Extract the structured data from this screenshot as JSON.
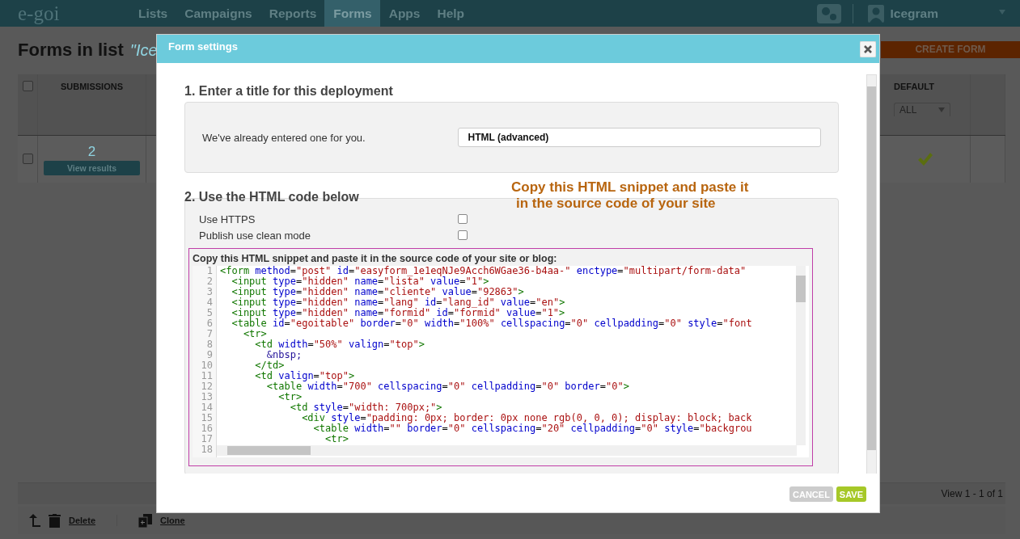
{
  "navbar": {
    "logo": "e-goi",
    "menu": [
      {
        "label": "Lists",
        "selected": false
      },
      {
        "label": "Campaigns",
        "selected": false
      },
      {
        "label": "Reports",
        "selected": false
      },
      {
        "label": "Forms",
        "selected": true
      },
      {
        "label": "Apps",
        "selected": false
      },
      {
        "label": "Help",
        "selected": false
      }
    ],
    "user": "Icegram"
  },
  "page": {
    "title": "Forms in list",
    "list_name": "\"Ice",
    "create_button": "CREATE FORM"
  },
  "table": {
    "all_checked": false,
    "submissions_header": "SUBMISSIONS",
    "default_header": "DEFAULT",
    "default_filter": "ALL",
    "rows": [
      {
        "checked": false,
        "submissions": "2",
        "action": "View results",
        "default": true
      }
    ],
    "pager": "View 1 - 1 of 1"
  },
  "toolbar": [
    {
      "kind": "delete",
      "label": "Delete"
    },
    {
      "kind": "clone",
      "label": "Clone"
    }
  ],
  "modal": {
    "title": "Form settings",
    "step1": {
      "heading": "1. Enter a title for this deployment",
      "label": "We've already entered one for you.",
      "value": "HTML (advanced)"
    },
    "step2": {
      "heading": "2. Use the HTML code below",
      "callout": [
        "Copy this HTML snippet and paste it",
        "in the source code of your site"
      ],
      "options": [
        {
          "label": "Use HTTPS",
          "checked": false
        },
        {
          "label": "Publish use clean mode",
          "checked": false
        }
      ],
      "snippet_label": "Copy this HTML snippet and paste it in the source code of your site or blog:",
      "lines": [
        {
          "n": "1",
          "code": [
            {
              "kind": "tag",
              "text": "<form"
            },
            {
              "kind": "attr",
              "text": " method"
            },
            {
              "kind": "op",
              "text": "="
            },
            {
              "kind": "str",
              "text": "\"post\""
            },
            {
              "kind": "attr",
              "text": " id"
            },
            {
              "kind": "op",
              "text": "="
            },
            {
              "kind": "str",
              "text": "\"easyform_1e1eqNJe9Acch6WGae36-b4aa-\""
            },
            {
              "kind": "attr",
              "text": " enctype"
            },
            {
              "kind": "op",
              "text": "="
            },
            {
              "kind": "str",
              "text": "\"multipart/form-data\""
            }
          ]
        },
        {
          "n": "2",
          "code": [
            {
              "kind": "tag",
              "text": "  <input"
            },
            {
              "kind": "attr",
              "text": " type"
            },
            {
              "kind": "op",
              "text": "="
            },
            {
              "kind": "str",
              "text": "\"hidden\""
            },
            {
              "kind": "attr",
              "text": " name"
            },
            {
              "kind": "op",
              "text": "="
            },
            {
              "kind": "str",
              "text": "\"lista\""
            },
            {
              "kind": "attr",
              "text": " value"
            },
            {
              "kind": "op",
              "text": "="
            },
            {
              "kind": "str",
              "text": "\"1\""
            },
            {
              "kind": "tag",
              "text": ">"
            }
          ]
        },
        {
          "n": "3",
          "code": [
            {
              "kind": "tag",
              "text": "  <input"
            },
            {
              "kind": "attr",
              "text": " type"
            },
            {
              "kind": "op",
              "text": "="
            },
            {
              "kind": "str",
              "text": "\"hidden\""
            },
            {
              "kind": "attr",
              "text": " name"
            },
            {
              "kind": "op",
              "text": "="
            },
            {
              "kind": "str",
              "text": "\"cliente\""
            },
            {
              "kind": "attr",
              "text": " value"
            },
            {
              "kind": "op",
              "text": "="
            },
            {
              "kind": "str",
              "text": "\"92863\""
            },
            {
              "kind": "tag",
              "text": ">"
            }
          ]
        },
        {
          "n": "4",
          "code": [
            {
              "kind": "tag",
              "text": "  <input"
            },
            {
              "kind": "attr",
              "text": " type"
            },
            {
              "kind": "op",
              "text": "="
            },
            {
              "kind": "str",
              "text": "\"hidden\""
            },
            {
              "kind": "attr",
              "text": " name"
            },
            {
              "kind": "op",
              "text": "="
            },
            {
              "kind": "str",
              "text": "\"lang\""
            },
            {
              "kind": "attr",
              "text": " id"
            },
            {
              "kind": "op",
              "text": "="
            },
            {
              "kind": "str",
              "text": "\"lang_id\""
            },
            {
              "kind": "attr",
              "text": " value"
            },
            {
              "kind": "op",
              "text": "="
            },
            {
              "kind": "str",
              "text": "\"en\""
            },
            {
              "kind": "tag",
              "text": ">"
            }
          ]
        },
        {
          "n": "5",
          "code": [
            {
              "kind": "tag",
              "text": "  <input"
            },
            {
              "kind": "attr",
              "text": " type"
            },
            {
              "kind": "op",
              "text": "="
            },
            {
              "kind": "str",
              "text": "\"hidden\""
            },
            {
              "kind": "attr",
              "text": " name"
            },
            {
              "kind": "op",
              "text": "="
            },
            {
              "kind": "str",
              "text": "\"formid\""
            },
            {
              "kind": "attr",
              "text": " id"
            },
            {
              "kind": "op",
              "text": "="
            },
            {
              "kind": "str",
              "text": "\"formid\""
            },
            {
              "kind": "attr",
              "text": " value"
            },
            {
              "kind": "op",
              "text": "="
            },
            {
              "kind": "str",
              "text": "\"1\""
            },
            {
              "kind": "tag",
              "text": ">"
            }
          ]
        },
        {
          "n": "6",
          "code": [
            {
              "kind": "tag",
              "text": "  <table"
            },
            {
              "kind": "attr",
              "text": " id"
            },
            {
              "kind": "op",
              "text": "="
            },
            {
              "kind": "str",
              "text": "\"egoitable\""
            },
            {
              "kind": "attr",
              "text": " border"
            },
            {
              "kind": "op",
              "text": "="
            },
            {
              "kind": "str",
              "text": "\"0\""
            },
            {
              "kind": "attr",
              "text": " width"
            },
            {
              "kind": "op",
              "text": "="
            },
            {
              "kind": "str",
              "text": "\"100%\""
            },
            {
              "kind": "attr",
              "text": " cellspacing"
            },
            {
              "kind": "op",
              "text": "="
            },
            {
              "kind": "str",
              "text": "\"0\""
            },
            {
              "kind": "attr",
              "text": " cellpadding"
            },
            {
              "kind": "op",
              "text": "="
            },
            {
              "kind": "str",
              "text": "\"0\""
            },
            {
              "kind": "attr",
              "text": " style"
            },
            {
              "kind": "op",
              "text": "="
            },
            {
              "kind": "str",
              "text": "\"font"
            }
          ]
        },
        {
          "n": "7",
          "code": [
            {
              "kind": "tag",
              "text": "    <tr>"
            }
          ]
        },
        {
          "n": "8",
          "code": [
            {
              "kind": "tag",
              "text": "      <td"
            },
            {
              "kind": "attr",
              "text": " width"
            },
            {
              "kind": "op",
              "text": "="
            },
            {
              "kind": "str",
              "text": "\"50%\""
            },
            {
              "kind": "attr",
              "text": " valign"
            },
            {
              "kind": "op",
              "text": "="
            },
            {
              "kind": "str",
              "text": "\"top\""
            },
            {
              "kind": "tag",
              "text": ">"
            }
          ]
        },
        {
          "n": "9",
          "code": [
            {
              "kind": "entity",
              "text": "        &nbsp;"
            }
          ]
        },
        {
          "n": "10",
          "code": [
            {
              "kind": "tag",
              "text": "      </td>"
            }
          ]
        },
        {
          "n": "11",
          "code": [
            {
              "kind": "tag",
              "text": "      <td"
            },
            {
              "kind": "attr",
              "text": " valign"
            },
            {
              "kind": "op",
              "text": "="
            },
            {
              "kind": "str",
              "text": "\"top\""
            },
            {
              "kind": "tag",
              "text": ">"
            }
          ]
        },
        {
          "n": "12",
          "code": [
            {
              "kind": "tag",
              "text": "        <table"
            },
            {
              "kind": "attr",
              "text": " width"
            },
            {
              "kind": "op",
              "text": "="
            },
            {
              "kind": "str",
              "text": "\"700\""
            },
            {
              "kind": "attr",
              "text": " cellspacing"
            },
            {
              "kind": "op",
              "text": "="
            },
            {
              "kind": "str",
              "text": "\"0\""
            },
            {
              "kind": "attr",
              "text": " cellpadding"
            },
            {
              "kind": "op",
              "text": "="
            },
            {
              "kind": "str",
              "text": "\"0\""
            },
            {
              "kind": "attr",
              "text": " border"
            },
            {
              "kind": "op",
              "text": "="
            },
            {
              "kind": "str",
              "text": "\"0\""
            },
            {
              "kind": "tag",
              "text": ">"
            }
          ]
        },
        {
          "n": "13",
          "code": [
            {
              "kind": "tag",
              "text": "          <tr>"
            }
          ]
        },
        {
          "n": "14",
          "code": [
            {
              "kind": "tag",
              "text": "            <td"
            },
            {
              "kind": "attr",
              "text": " style"
            },
            {
              "kind": "op",
              "text": "="
            },
            {
              "kind": "str",
              "text": "\"width: 700px;\""
            },
            {
              "kind": "tag",
              "text": ">"
            }
          ]
        },
        {
          "n": "15",
          "code": [
            {
              "kind": "tag",
              "text": "              <div"
            },
            {
              "kind": "attr",
              "text": " style"
            },
            {
              "kind": "op",
              "text": "="
            },
            {
              "kind": "str",
              "text": "\"padding: 0px; border: 0px none rgb(0, 0, 0); display: block; back"
            }
          ]
        },
        {
          "n": "16",
          "code": [
            {
              "kind": "tag",
              "text": "                <table"
            },
            {
              "kind": "attr",
              "text": " width"
            },
            {
              "kind": "op",
              "text": "="
            },
            {
              "kind": "str",
              "text": "\"\""
            },
            {
              "kind": "attr",
              "text": " border"
            },
            {
              "kind": "op",
              "text": "="
            },
            {
              "kind": "str",
              "text": "\"0\""
            },
            {
              "kind": "attr",
              "text": " cellspacing"
            },
            {
              "kind": "op",
              "text": "="
            },
            {
              "kind": "str",
              "text": "\"20\""
            },
            {
              "kind": "attr",
              "text": " cellpadding"
            },
            {
              "kind": "op",
              "text": "="
            },
            {
              "kind": "str",
              "text": "\"0\""
            },
            {
              "kind": "attr",
              "text": " style"
            },
            {
              "kind": "op",
              "text": "="
            },
            {
              "kind": "str",
              "text": "\"backgrou"
            }
          ]
        },
        {
          "n": "17",
          "code": [
            {
              "kind": "tag",
              "text": "                  <tr>"
            }
          ]
        },
        {
          "n": "18"
        }
      ]
    },
    "buttons": [
      {
        "kind": "cancel",
        "label": "CANCEL"
      },
      {
        "kind": "save",
        "label": "SAVE"
      }
    ]
  }
}
